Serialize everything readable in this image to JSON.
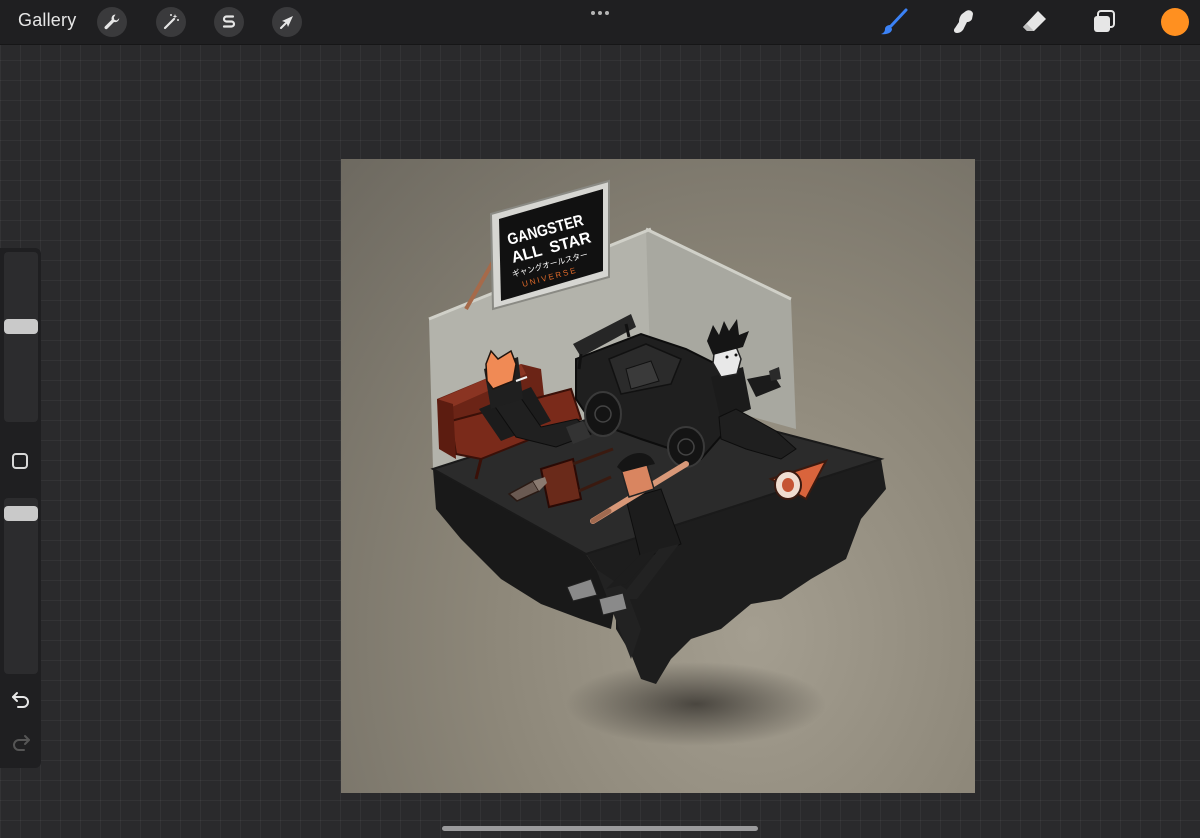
{
  "toolbar": {
    "gallery_label": "Gallery",
    "left_tools": [
      "wrench-icon",
      "magic-wand-icon",
      "selection-s-icon",
      "transform-arrow-icon"
    ],
    "right_tools": [
      "brush-icon",
      "smudge-icon",
      "eraser-icon",
      "layers-icon"
    ],
    "active_tool": "brush-icon",
    "accent_color": "#3b82f6",
    "current_color": "#ff9020"
  },
  "sidebar": {
    "brush_size": 0.57,
    "opacity": 0.95,
    "icons": [
      "modify-square-icon",
      "undo-icon",
      "redo-icon"
    ]
  },
  "artwork": {
    "sign_line1": "GANGSTER",
    "sign_line2a": "ALL",
    "sign_line2b": "STAR",
    "sign_line3": "ギャングオールスター",
    "sign_line4": "UNIVERSE",
    "colors": {
      "background": "#8d8779",
      "floor": "#2b2b2b",
      "base": "#1a1a1a",
      "wall": "#b3b3ab",
      "sofa": "#7a2a1a",
      "orange_mask": "#f08a55",
      "skin": "#d98560",
      "cone": "#d9643c",
      "sign_accent": "#e06a2a"
    }
  }
}
